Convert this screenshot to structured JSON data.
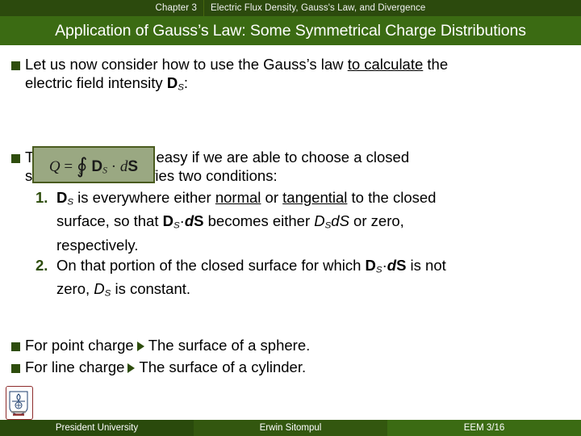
{
  "header": {
    "chapter_number": "Chapter 3",
    "chapter_title": "Electric Flux Density, Gauss's Law, and Divergence",
    "slide_title": "Application of Gauss’s Law: Some Symmetrical Charge Distributions"
  },
  "colors": {
    "topbar": "#2c4a0d",
    "titlebar": "#3b6b13",
    "bullet_square": "#2e4d0d",
    "equation_box_fill": "#9aa882",
    "equation_box_border": "#4a5c1f",
    "number_marker": "#2e4d0d",
    "logo_border": "#8d2b2b"
  },
  "body": {
    "bullet1": {
      "line1_a": "Let us now consider how to use the Gauss’s law ",
      "line1_underlined": "to calculate",
      "line1_b": " the",
      "line2_a": "electric field intensity ",
      "line2_symbol": "D",
      "line2_sub": "S",
      "line2_b": ":"
    },
    "equation": {
      "lhs": "Q",
      "equals": "=",
      "integral": "∮",
      "integral_sub": "S",
      "vector": "D",
      "vector_sub": "S",
      "dot": "·",
      "differential_d": "d",
      "differential_S": "S",
      "plain_text": "Q = ∮ S Dₛ · dS"
    },
    "bullet2": {
      "line1": "The solution will be easy if we are able to choose a closed",
      "line2": "surface which satisfies two conditions:"
    },
    "conditions": [
      {
        "number": "1.",
        "seg1_bold": "D",
        "seg1_sub": "S",
        "seg2": " is everywhere either ",
        "underline1": "normal",
        "seg3": " or ",
        "underline2": "tangential",
        "seg4": " to the closed",
        "line2_a": "surface, so that ",
        "line2_bold": "D",
        "line2_sub": "S",
        "line2_dot": "·",
        "line2_d": "d",
        "line2_S": "S",
        "line2_b": " becomes either ",
        "line2_italic_D": "D",
        "line2_italic_sub": "S",
        "line2_italic_dS": "dS",
        "line2_c": " or zero,",
        "line3": "respectively."
      },
      {
        "number": "2.",
        "seg1": "On that portion of the closed surface for which ",
        "seg2_bold": "D",
        "seg2_sub": "S",
        "seg2_dot": "·",
        "seg2_d": "d",
        "seg2_S": "S",
        "seg3": " is not",
        "line2_a": "zero, ",
        "line2_italic_D": "D",
        "line2_italic_sub": "S",
        "line2_b": " is constant."
      }
    ],
    "arrow_bullets": [
      {
        "label": "For point charge",
        "arrow": "►",
        "result": "The surface of a sphere."
      },
      {
        "label": "For line charge",
        "arrow": "►",
        "result": "The surface of a cylinder."
      }
    ]
  },
  "footer": {
    "left": "President University",
    "center": "Erwin Sitompul",
    "right": "EEM 3/16"
  },
  "logo": {
    "name": "president-university-crest"
  }
}
